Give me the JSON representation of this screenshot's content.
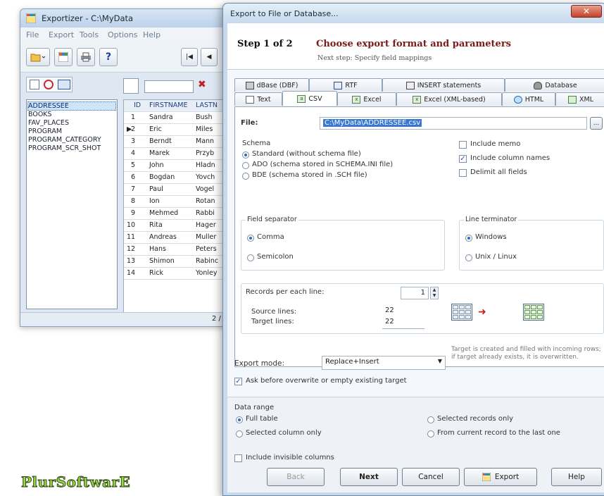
{
  "main_window": {
    "title": "Exportizer - C:\\MyData",
    "menu": [
      "File",
      "Export",
      "Tools",
      "Options",
      "Help"
    ],
    "tables": [
      "ADDRESSEE",
      "BOOKS",
      "FAV_PLACES",
      "PROGRAM",
      "PROGRAM_CATEGORY",
      "PROGRAM_SCR_SHOT"
    ],
    "selected_table": "ADDRESSEE",
    "grid": {
      "columns": [
        "ID",
        "FIRSTNAME",
        "LASTN"
      ],
      "rows": [
        [
          "1",
          "Sandra",
          "Bush"
        ],
        [
          "2",
          "Eric",
          "Miles"
        ],
        [
          "3",
          "Berndt",
          "Mann"
        ],
        [
          "4",
          "Marek",
          "Przyb"
        ],
        [
          "5",
          "John",
          "Hladn"
        ],
        [
          "6",
          "Bogdan",
          "Yovch"
        ],
        [
          "7",
          "Paul",
          "Vogel"
        ],
        [
          "8",
          "Ion",
          "Rotan"
        ],
        [
          "9",
          "Mehmed",
          "Rabbi"
        ],
        [
          "10",
          "Rita",
          "Hager"
        ],
        [
          "11",
          "Andreas",
          "Muller"
        ],
        [
          "12",
          "Hans",
          "Peters"
        ],
        [
          "13",
          "Shimon",
          "Rabinc"
        ],
        [
          "14",
          "Rick",
          "Yonley"
        ]
      ]
    },
    "status": "2 /"
  },
  "dialog": {
    "title": "Export to File or Database...",
    "close_label": "✕",
    "step_num": "Step 1 of 2",
    "step_title": "Choose export format and parameters",
    "step_next": "Next step: Specify field mappings",
    "tabs_row1": [
      "dBase (DBF)",
      "RTF",
      "INSERT statements",
      "Database"
    ],
    "tabs_row2": [
      "Text",
      "CSV",
      "Excel",
      "Excel (XML-based)",
      "HTML",
      "XML"
    ],
    "active_tab": "CSV",
    "file_label": "File:",
    "file_value": "C:\\MyData\\ADDRESSEE.csv",
    "browse_label": "...",
    "schema_legend": "Schema",
    "schema_options": [
      "Standard (without schema file)",
      "ADO (schema stored in SCHEMA.INI file)",
      "BDE (schema stored in .SCH file)"
    ],
    "checks": [
      {
        "label": "Include memo",
        "checked": false
      },
      {
        "label": "Include column names",
        "checked": true
      },
      {
        "label": "Delimit all fields",
        "checked": false
      }
    ],
    "field_sep_legend": "Field separator",
    "field_sep_options": [
      "Comma",
      "Semicolon"
    ],
    "line_term_legend": "Line terminator",
    "line_term_options": [
      "Windows",
      "Unix / Linux"
    ],
    "records_label": "Records per each line:",
    "records_value": "1",
    "source_label": "Source lines:",
    "source_value": "22",
    "target_label": "Target lines:",
    "target_value": "22",
    "export_mode_label": "Export mode:",
    "export_mode_value": "Replace+Insert",
    "export_mode_note": "Target is created and filled with incoming rows; if target already exists, it is overwritten.",
    "ask_label": "Ask before overwrite or empty existing target",
    "data_range_legend": "Data range",
    "range_options": [
      "Full table",
      "Selected records only",
      "Selected column only",
      "From current record to the last one"
    ],
    "invisible_label": "Include invisible columns",
    "buttons": {
      "back": "Back",
      "next": "Next",
      "cancel": "Cancel",
      "export": "Export",
      "help": "Help"
    }
  },
  "logo_text": "PlurSoftwarE"
}
